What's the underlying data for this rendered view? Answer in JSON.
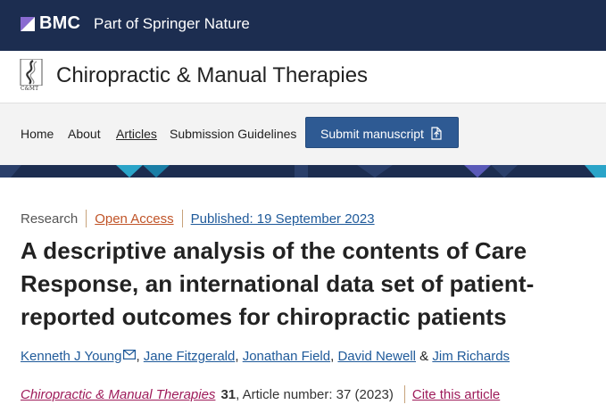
{
  "header": {
    "brand": "BMC",
    "tagline": "Part of Springer Nature"
  },
  "journal": {
    "logo_text": "C&MT",
    "title": "Chiropractic & Manual Therapies"
  },
  "nav": {
    "items": [
      {
        "label": "Home"
      },
      {
        "label": "About"
      },
      {
        "label": "Articles"
      },
      {
        "label": "Submission Guidelines"
      }
    ],
    "submit_label": "Submit manuscript"
  },
  "article": {
    "type": "Research",
    "access": "Open Access",
    "published": "Published: 19 September 2023",
    "title": "A descriptive analysis of the contents of Care Response, an international data set of patient-reported outcomes for chiropractic patients",
    "authors": [
      "Kenneth J Young",
      "Jane Fitzgerald",
      "Jonathan Field",
      "David Newell",
      "Jim Richards"
    ],
    "author_sep": ",",
    "author_and": "&",
    "citation": {
      "journal": "Chiropractic & Manual Therapies",
      "volume": "31",
      "rest": ", Article number: 37 (2023)",
      "cite_label": "Cite this article"
    }
  },
  "colors": {
    "header_bg": "#1c2d50",
    "accent_magenta": "#9e1b5a",
    "link_blue": "#1f5a9a",
    "open_access_orange": "#c05428",
    "submit_button": "#2e5a93"
  }
}
